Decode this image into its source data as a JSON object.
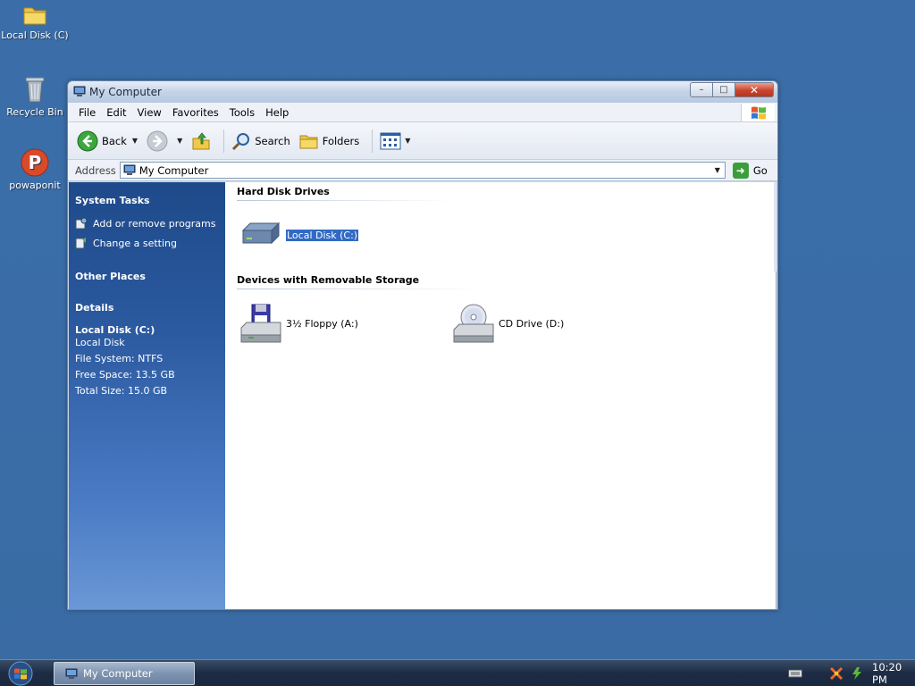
{
  "desktop": {
    "icons": [
      {
        "label": "Local Disk (C)",
        "icon": "folder-icon"
      },
      {
        "label": "Recycle Bin",
        "icon": "recycle-bin-icon"
      },
      {
        "label": "powaponit",
        "icon": "powaponit-icon"
      }
    ]
  },
  "window": {
    "title": "My Computer",
    "controls": {
      "minimize": "–",
      "maximize": "□",
      "close": "✕"
    },
    "menu": [
      "File",
      "Edit",
      "View",
      "Favorites",
      "Tools",
      "Help"
    ],
    "toolbar": {
      "back_label": "Back",
      "search_label": "Search",
      "folders_label": "Folders"
    },
    "address": {
      "label": "Address",
      "value": "My Computer",
      "go_label": "Go"
    }
  },
  "taskpane": {
    "system_tasks": {
      "heading": "System Tasks",
      "links": [
        "Add or remove programs",
        "Change a setting"
      ]
    },
    "other_places": {
      "heading": "Other Places"
    },
    "details": {
      "heading": "Details",
      "title": "Local Disk (C:)",
      "subtitle": "Local Disk",
      "file_system": "File System: NTFS",
      "free_space": "Free Space: 13.5 GB",
      "total_size": "Total Size: 15.0 GB"
    }
  },
  "main": {
    "hard_disk_heading": "Hard Disk Drives",
    "removable_heading": "Devices with Removable Storage",
    "drives": {
      "local_disk": "Local Disk (C:)",
      "floppy": "3½ Floppy (A:)",
      "cd": "CD Drive (D:)"
    }
  },
  "taskbar": {
    "task_label": "My Computer",
    "clock": "10:20 PM"
  },
  "colors": {
    "desktop": "#3a6ea5",
    "taskpane_top": "#1e4a8a",
    "selection": "#316ac5"
  }
}
